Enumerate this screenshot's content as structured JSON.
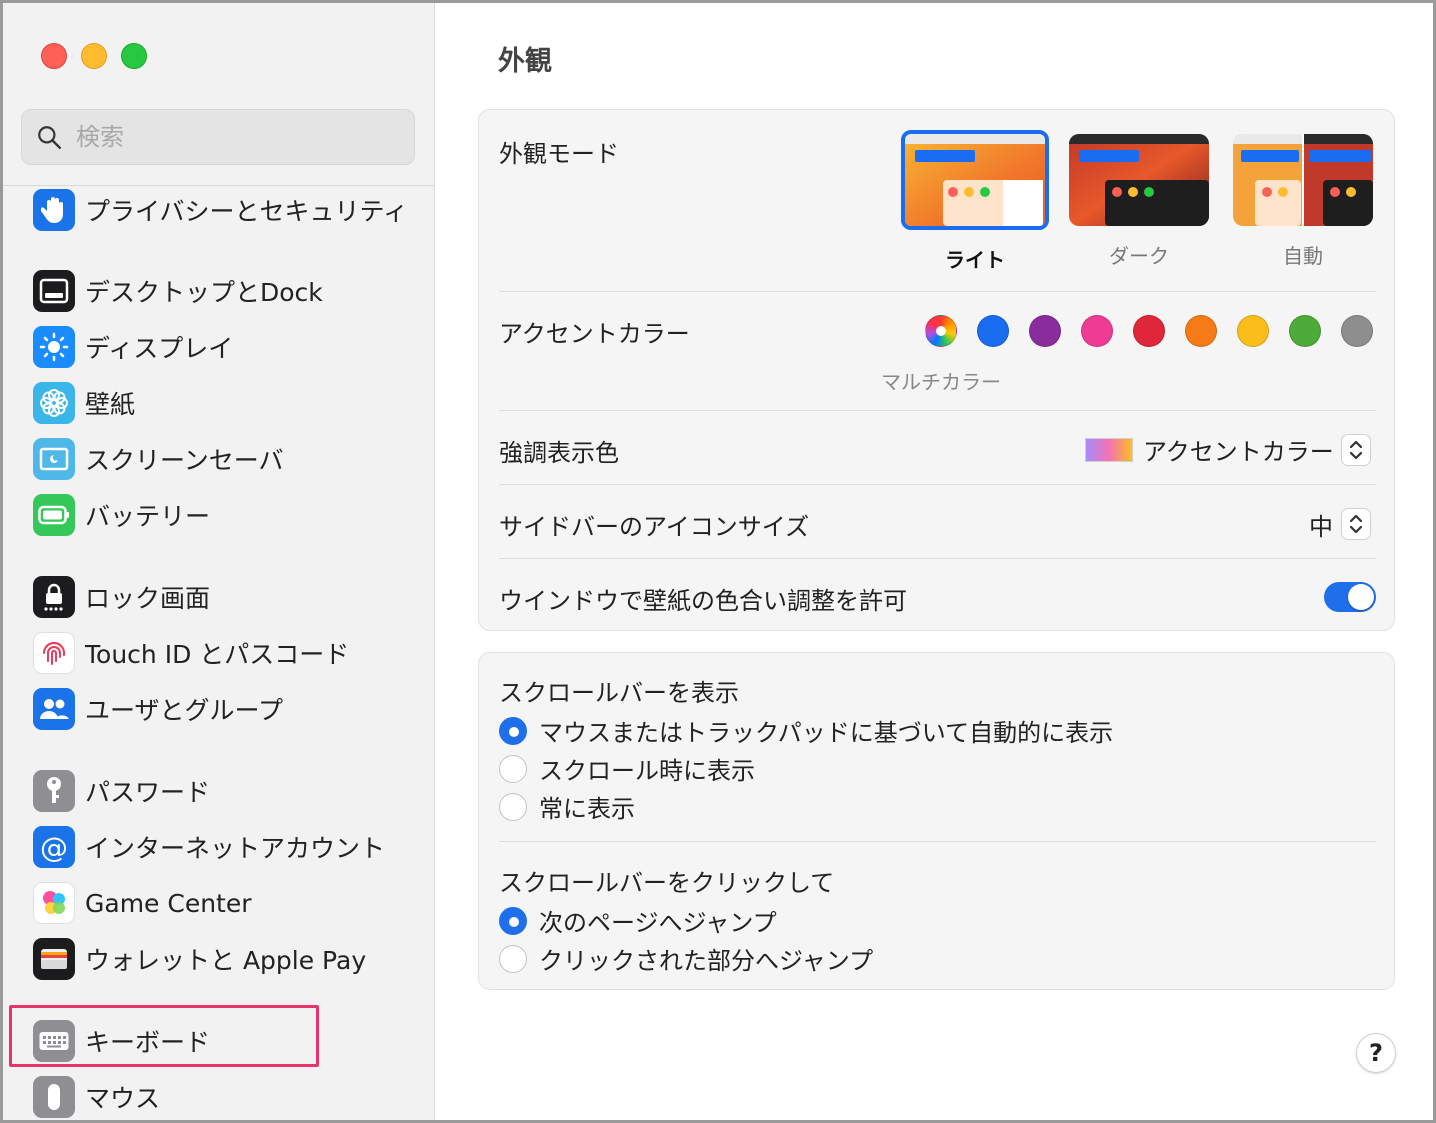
{
  "sidebar": {
    "search_placeholder": "検索",
    "items": [
      {
        "label": "プライバシーとセキュリティ",
        "icon": "hand-icon",
        "color": "#1a73e8"
      },
      {
        "label": "デスクトップとDock",
        "icon": "dock-icon",
        "color": "#1c1c1e"
      },
      {
        "label": "ディスプレイ",
        "icon": "sun-icon",
        "color": "#1a8cff"
      },
      {
        "label": "壁紙",
        "icon": "flower-icon",
        "color": "#3ab6e8"
      },
      {
        "label": "スクリーンセーバ",
        "icon": "screensaver-icon",
        "color": "#4fb8e8"
      },
      {
        "label": "バッテリー",
        "icon": "battery-icon",
        "color": "#34c759"
      },
      {
        "label": "ロック画面",
        "icon": "lock-icon",
        "color": "#1c1c1e"
      },
      {
        "label": "Touch ID とパスコード",
        "icon": "fingerprint-icon",
        "color": "#ffffff"
      },
      {
        "label": "ユーザとグループ",
        "icon": "users-icon",
        "color": "#1a73e8"
      },
      {
        "label": "パスワード",
        "icon": "key-icon",
        "color": "#8e8e93"
      },
      {
        "label": "インターネットアカウント",
        "icon": "at-icon",
        "color": "#1a73e8"
      },
      {
        "label": "Game Center",
        "icon": "game-center-icon",
        "color": "#ffffff"
      },
      {
        "label": "ウォレットと Apple Pay",
        "icon": "wallet-icon",
        "color": "#1c1c1e"
      },
      {
        "label": "キーボード",
        "icon": "keyboard-icon",
        "color": "#8e8e93"
      },
      {
        "label": "マウス",
        "icon": "mouse-icon",
        "color": "#8e8e93"
      }
    ]
  },
  "main": {
    "title": "外観",
    "appearance": {
      "label": "外観モード",
      "options": [
        {
          "label": "ライト",
          "selected": true
        },
        {
          "label": "ダーク",
          "selected": false
        },
        {
          "label": "自動",
          "selected": false
        }
      ]
    },
    "accent": {
      "label": "アクセントカラー",
      "selected_caption": "マルチカラー",
      "colors": [
        "multicolor",
        "#1a6cf0",
        "#8a2d9c",
        "#ee3c95",
        "#e0263a",
        "#f47b16",
        "#fbbd19",
        "#4dac39",
        "#8e8e8e"
      ]
    },
    "highlight": {
      "label": "強調表示色",
      "value": "アクセントカラー"
    },
    "sidebar_icon_size": {
      "label": "サイドバーのアイコンサイズ",
      "value": "中"
    },
    "wallpaper_tinting": {
      "label": "ウインドウで壁紙の色合い調整を許可",
      "enabled": true
    },
    "show_scrollbars": {
      "label": "スクロールバーを表示",
      "options": [
        {
          "label": "マウスまたはトラックパッドに基づいて自動的に表示",
          "selected": true
        },
        {
          "label": "スクロール時に表示",
          "selected": false
        },
        {
          "label": "常に表示",
          "selected": false
        }
      ]
    },
    "click_scrollbar": {
      "label": "スクロールバーをクリックして",
      "options": [
        {
          "label": "次のページへジャンプ",
          "selected": true
        },
        {
          "label": "クリックされた部分へジャンプ",
          "selected": false
        }
      ]
    },
    "help_label": "?"
  }
}
